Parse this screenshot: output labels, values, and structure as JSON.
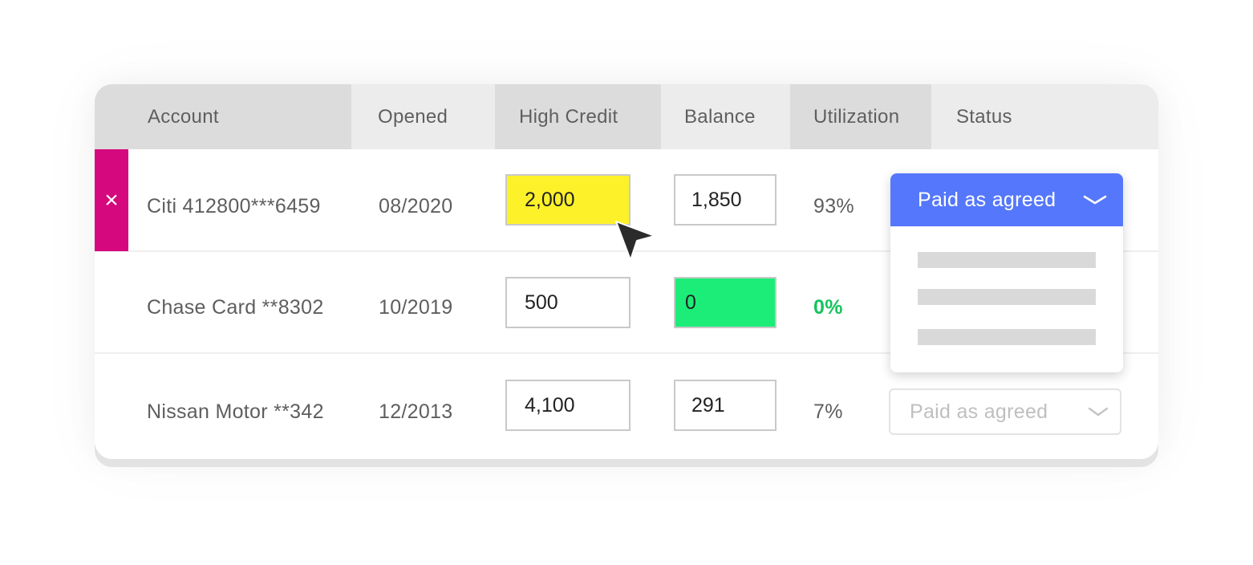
{
  "columns": [
    "Account",
    "Opened",
    "High Credit",
    "Balance",
    "Utilization",
    "Status"
  ],
  "rows": [
    {
      "account": "Citi 412800***6459",
      "opened": "08/2020",
      "high_credit": "2,000",
      "balance": "1,850",
      "utilization": "93%",
      "status": "Paid as agreed"
    },
    {
      "account": "Chase Card **8302",
      "opened": "10/2019",
      "high_credit": "500",
      "balance": "0",
      "utilization": "0%"
    },
    {
      "account": "Nissan Motor **342",
      "opened": "12/2013",
      "high_credit": "4,100",
      "balance": "291",
      "utilization": "7%",
      "status": "Paid as agreed"
    }
  ],
  "remove_button": "×",
  "colors": {
    "accent_blue": "#5577fb",
    "remove_magenta": "#d6087e",
    "highlight_yellow": "#fdf12a",
    "highlight_green": "#1ced79",
    "positive_text": "#16c35e"
  },
  "icons": [
    "close-icon",
    "chevron-down-icon",
    "mouse-pointer-icon"
  ]
}
